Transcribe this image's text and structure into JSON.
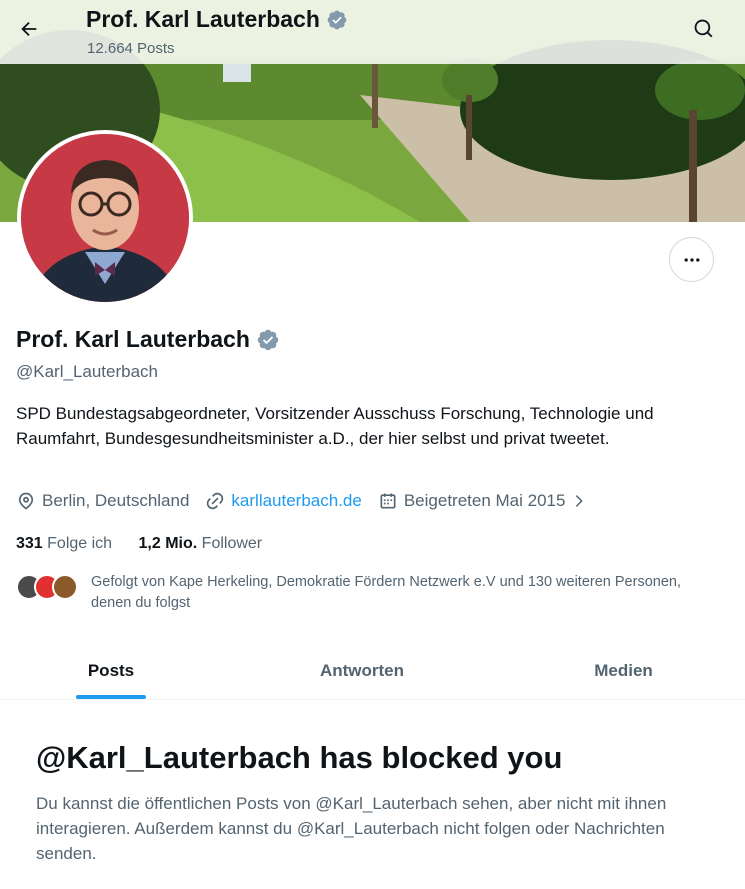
{
  "header": {
    "title": "Prof. Karl Lauterbach",
    "posts_count": "12.664 Posts",
    "icons": {
      "back": "arrow-left-icon",
      "search": "search-icon",
      "verified": "verified-badge-icon"
    }
  },
  "profile": {
    "name": "Prof. Karl Lauterbach",
    "handle": "@Karl_Lauterbach",
    "bio": "SPD Bundestagsabgeordneter, Vorsitzender Ausschuss Forschung, Technologie und Raumfahrt, Bundesgesundheitsminister a.D., der hier selbst und privat tweetet.",
    "location": "Berlin, Deutschland",
    "website": "karllauterbach.de",
    "joined": "Beigetreten Mai 2015",
    "following_count": "331",
    "following_label": "Folge ich",
    "followers_count": "1,2 Mio.",
    "followers_label": "Follower",
    "known_followers": "Gefolgt von Kape Herkeling, Demokratie Fördern Netzwerk e.V und 130 weiteren Personen, denen du folgst"
  },
  "tabs": [
    {
      "label": "Posts",
      "active": true
    },
    {
      "label": "Antworten",
      "active": false
    },
    {
      "label": "Medien",
      "active": false
    }
  ],
  "blocked": {
    "title": "@Karl_Lauterbach has blocked you",
    "message": "Du kannst die öffentlichen Posts von @Karl_Lauterbach sehen, aber nicht mit ihnen interagieren. Außerdem kannst du @Karl_Lauterbach nicht folgen oder Nachrichten senden."
  },
  "colors": {
    "accent": "#1d9bf0",
    "text": "#0f1419",
    "secondary": "#536471",
    "verified": "#829aab"
  }
}
